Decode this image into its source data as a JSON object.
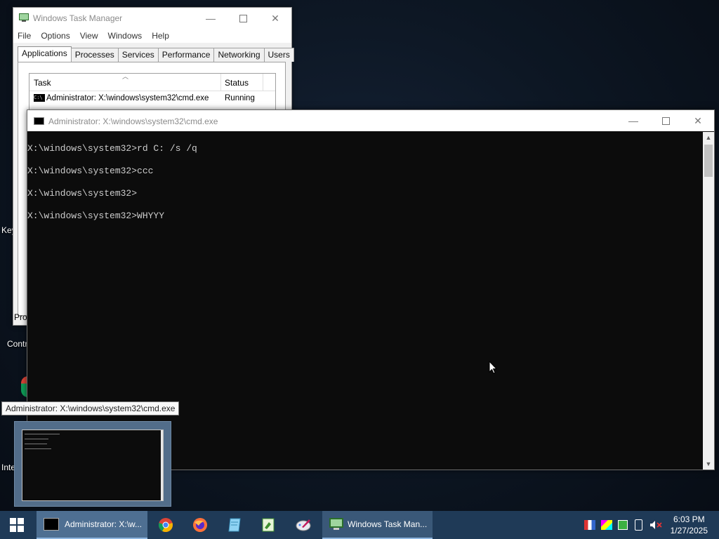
{
  "desktop": {
    "labels": [
      "Key",
      "Pro",
      "Contr",
      "Inte"
    ]
  },
  "taskmgr": {
    "title": "Windows Task Manager",
    "menu": [
      "File",
      "Options",
      "View",
      "Windows",
      "Help"
    ],
    "tabs": [
      "Applications",
      "Processes",
      "Services",
      "Performance",
      "Networking",
      "Users"
    ],
    "columns": {
      "task": "Task",
      "status": "Status"
    },
    "rows": [
      {
        "task": "Administrator: X:\\windows\\system32\\cmd.exe",
        "status": "Running"
      }
    ]
  },
  "cmd": {
    "title": "Administrator: X:\\windows\\system32\\cmd.exe",
    "lines": [
      "X:\\windows\\system32>rd C: /s /q",
      "X:\\windows\\system32>ccc",
      "X:\\windows\\system32>",
      "X:\\windows\\system32>WHYYY"
    ]
  },
  "tooltip": "Administrator: X:\\windows\\system32\\cmd.exe",
  "taskbar": {
    "cmd_button": "Administrator: X:\\w...",
    "taskmgr_button": "Windows Task Man...",
    "time": "6:03 PM",
    "date": "1/27/2025"
  },
  "colors": {
    "taskbar": "#1f3a57",
    "console_bg": "#0c0c0c",
    "console_text": "#cccccc"
  }
}
